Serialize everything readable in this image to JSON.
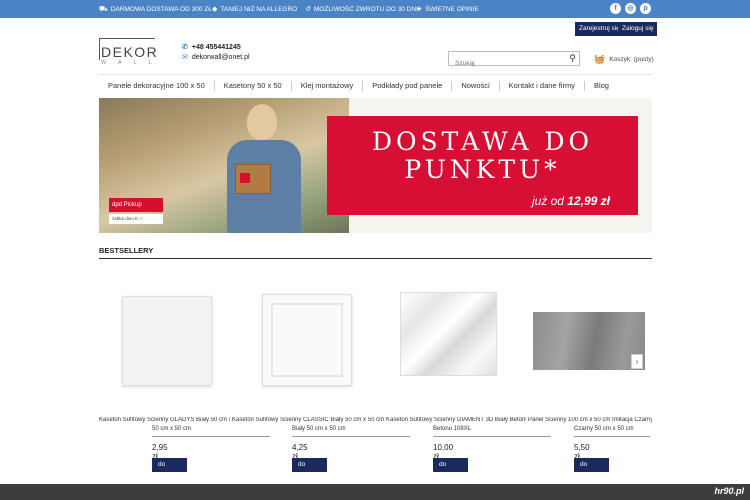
{
  "topbar": {
    "promos": [
      {
        "icon": "truck-icon",
        "text": "DARMOWA DOSTAWA OD 300 ZŁ"
      },
      {
        "icon": "tag-icon",
        "text": "TANIEJ NIŻ NA ALLEGRO"
      },
      {
        "icon": "return-icon",
        "text": "MOŻLIWOŚĆ ZWROTU DO 30 DNI"
      },
      {
        "icon": "star-icon",
        "text": "ŚWIETNE OPINIE"
      }
    ],
    "social": [
      {
        "icon": "facebook-icon",
        "glyph": "f"
      },
      {
        "icon": "instagram-icon",
        "glyph": "◎"
      },
      {
        "icon": "pinterest-icon",
        "glyph": "p"
      }
    ]
  },
  "account": {
    "register_label": "Zarejestruj się",
    "login_label": "Zaloguj się"
  },
  "logo": {
    "name": "DEKOR",
    "sub": "WALL"
  },
  "contact": {
    "phone": "+48 455441245",
    "email": "dekorwall@onet.pl"
  },
  "search": {
    "placeholder": "Szukaj"
  },
  "cart": {
    "label": "Koszyk: (pusty)"
  },
  "nav": {
    "items": [
      "Panele dekoracyjne 100 x 50",
      "Kasetony 50 x 50",
      "Klej montażowy",
      "Podkłady pod panele",
      "Nowości",
      "Kontakt i dane firmy",
      "Blog"
    ]
  },
  "hero": {
    "line1": "DOSTAWA DO",
    "line2": "PUNKTU*",
    "line3_prefix": "już od ",
    "line3_price": "12,99 zł",
    "badge_dpd": "dpd Pickup",
    "badge_row": "żabka  dino  K  ☆"
  },
  "bestsellers": {
    "title": "BESTSELLERY",
    "products": [
      {
        "name": "Kaseton Sufitowy Ścienny GLADYS Biały 50 cm x 50 cm",
        "size": "50 cm x 50 cm",
        "price": "2,95 zł",
        "button": "do koszyka"
      },
      {
        "name": "Kaseton Sufitowy Ścienny CLASSIC Biały 50 cm x 50 cm",
        "size": "Biały 50 cm x 50 cm",
        "price": "4,25 zł",
        "button": "do koszyka"
      },
      {
        "name": "Kaseton Sufitowy Ścienny DIAMENT 3D Biały Betonu 108XL",
        "size": "Betonu 108XL",
        "price": "10,00 zł",
        "button": "do koszyka"
      },
      {
        "name": "Panel Ścienny 100 cm x 50 cm Imitacja Czarny 50 cm x 50 cm",
        "size": "Czarny 50 cm x 50 cm",
        "price": "5,50 zł",
        "button": "do koszyka"
      }
    ]
  },
  "watermark": {
    "text": "hr90.pl"
  }
}
